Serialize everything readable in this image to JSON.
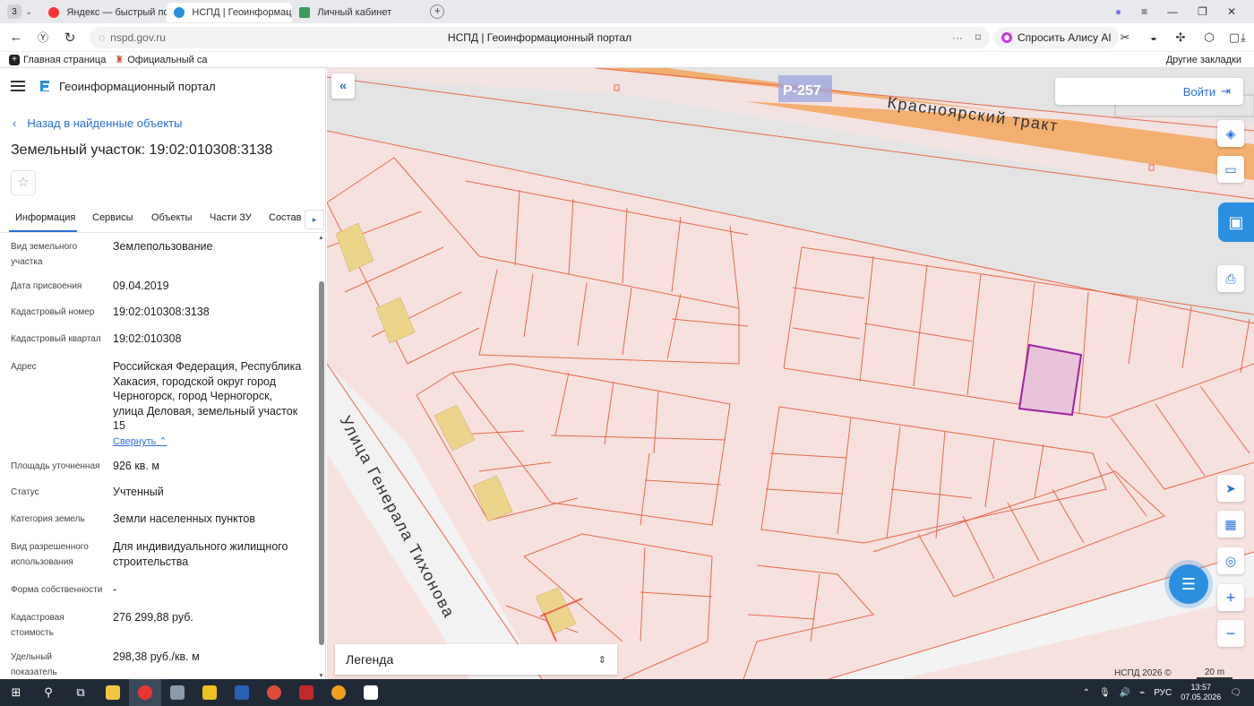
{
  "browser": {
    "tab_count": "3",
    "tabs": [
      {
        "label": "Яндекс — быстрый поиск",
        "icon": "yandex-icon"
      },
      {
        "label": "НСПД | Геоинформац",
        "icon": "nspd-icon"
      },
      {
        "label": "Личный кабинет",
        "icon": "cabinet-icon"
      }
    ],
    "url": "nspd.gov.ru",
    "page_title": "НСПД | Геоинформационный портал",
    "alice_label": "Спросить Алису AI",
    "bookmarks": [
      "Главная страница",
      "Официальный са"
    ],
    "other_bookmarks": "Другие закладки"
  },
  "portal": {
    "name": "Геоинформационный портал",
    "back_link": "Назад в найденные объекты",
    "object_title": "Земельный участок: 19:02:010308:3138",
    "tabs": [
      "Информация",
      "Сервисы",
      "Объекты",
      "Части ЗУ",
      "Состав"
    ],
    "collapse_link": "Свернуть"
  },
  "info": {
    "land_type_label": "Вид земельного участка",
    "land_type_value": "Землепользование",
    "assign_date_label": "Дата присвоения",
    "assign_date_value": "09.04.2019",
    "cad_number_label": "Кадастровый номер",
    "cad_number_value": "19:02:010308:3138",
    "cad_quarter_label": "Кадастровый квартал",
    "cad_quarter_value": "19:02:010308",
    "address_label": "Адрес",
    "address_value": "Российская Федерация, Республика Хакасия, городской округ город Черногорск, город Черногорск, улица Деловая, земельный участок 15",
    "area_label": "Площадь уточненная",
    "area_value": "926 кв. м",
    "status_label": "Статус",
    "status_value": "Учтенный",
    "category_label": "Категория земель",
    "category_value": "Земли населенных пунктов",
    "permitted_use_label": "Вид разрешенного использования",
    "permitted_use_value": "Для индивидуального жилищного строительства",
    "ownership_label": "Форма собственности",
    "ownership_value": "-",
    "cad_value_label": "Кадастровая стоимость",
    "cad_value_value": "276 299,88 руб.",
    "specific_label": "Удельный показатель кадастровой",
    "specific_value": "298,38 руб./кв. м"
  },
  "map": {
    "road_badge": "Р-257",
    "road_name": "Красноярский тракт",
    "street_name": "Улица Генерала Тихонова",
    "login_label": "Войти",
    "legend_label": "Легенда",
    "copyright": "НСПД 2026 ©",
    "scale_label": "20 m",
    "colors": {
      "parcel_fill": "#f6e1df",
      "parcel_stroke": "#e8694a",
      "selected_fill": "#e8c4d8",
      "selected_stroke": "#a020a0",
      "building": "#ecd58a",
      "road": "#f2a65a"
    }
  },
  "taskbar": {
    "time": "13:57",
    "date": "07.05.2026",
    "lang": "РУС"
  }
}
